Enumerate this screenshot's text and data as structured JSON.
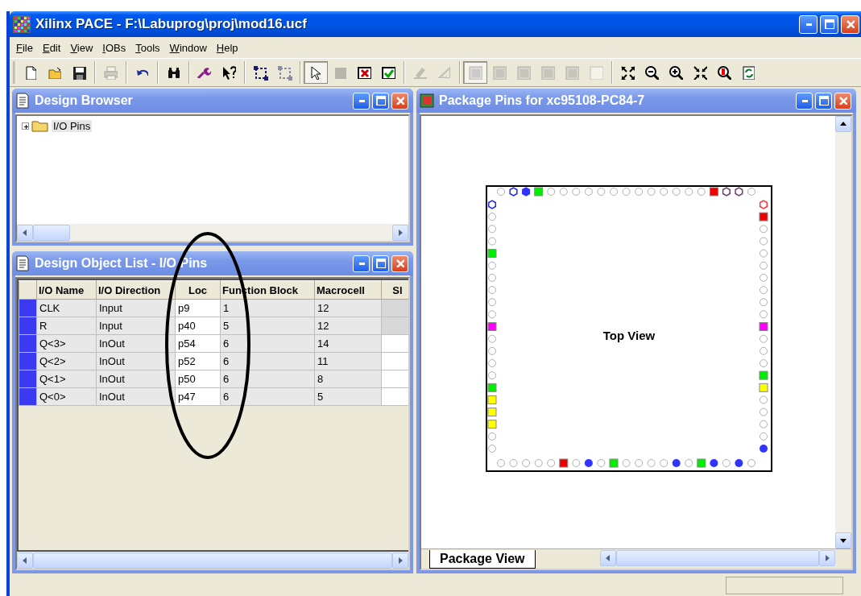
{
  "window": {
    "title": "Xilinx PACE - F:\\Labuprog\\proj\\mod16.ucf"
  },
  "menu": [
    "File",
    "Edit",
    "View",
    "IOBs",
    "Tools",
    "Window",
    "Help"
  ],
  "toolbar_groups": [
    {
      "buttons": [
        {
          "kind": "new",
          "disabled": false,
          "pressed": false
        },
        {
          "kind": "open",
          "disabled": false,
          "pressed": false
        },
        {
          "kind": "save",
          "disabled": false,
          "pressed": false
        }
      ]
    },
    {
      "buttons": [
        {
          "kind": "print",
          "disabled": true,
          "pressed": false
        }
      ]
    },
    {
      "buttons": [
        {
          "kind": "undo",
          "disabled": false,
          "pressed": false
        }
      ]
    },
    {
      "buttons": [
        {
          "kind": "find",
          "disabled": false,
          "pressed": false
        }
      ]
    },
    {
      "buttons": [
        {
          "kind": "wrench",
          "disabled": false,
          "pressed": false
        },
        {
          "kind": "help",
          "disabled": false,
          "pressed": false
        }
      ]
    },
    {
      "buttons": [
        {
          "kind": "select-area",
          "disabled": false,
          "pressed": false
        },
        {
          "kind": "select-area",
          "disabled": true,
          "pressed": false
        }
      ]
    },
    {
      "buttons": [
        {
          "kind": "pointer",
          "disabled": false,
          "pressed": true
        },
        {
          "kind": "square",
          "disabled": true,
          "pressed": false
        },
        {
          "kind": "x-box",
          "disabled": false,
          "pressed": false
        },
        {
          "kind": "check-box",
          "disabled": false,
          "pressed": false
        }
      ]
    },
    {
      "buttons": [
        {
          "kind": "pen",
          "disabled": true,
          "pressed": false
        },
        {
          "kind": "ruler",
          "disabled": true,
          "pressed": false
        }
      ]
    },
    {
      "buttons": [
        {
          "kind": "pattern",
          "disabled": true,
          "pressed": true
        },
        {
          "kind": "pattern",
          "disabled": true,
          "pressed": false
        },
        {
          "kind": "pattern",
          "disabled": true,
          "pressed": false
        },
        {
          "kind": "pattern",
          "disabled": true,
          "pressed": false
        },
        {
          "kind": "pattern",
          "disabled": true,
          "pressed": false
        },
        {
          "kind": "blank",
          "disabled": true,
          "pressed": false
        }
      ]
    },
    {
      "buttons": [
        {
          "kind": "fit",
          "disabled": false,
          "pressed": false
        },
        {
          "kind": "zoom-out",
          "disabled": false,
          "pressed": false
        },
        {
          "kind": "zoom-in",
          "disabled": false,
          "pressed": false
        },
        {
          "kind": "shrink",
          "disabled": false,
          "pressed": false
        },
        {
          "kind": "zoom-red",
          "disabled": false,
          "pressed": false
        },
        {
          "kind": "refresh",
          "disabled": false,
          "pressed": false
        }
      ]
    }
  ],
  "design_browser": {
    "title": "Design Browser",
    "tree": [
      {
        "label": "I/O Pins",
        "expanded": false,
        "selected": true
      }
    ]
  },
  "object_list": {
    "title": "Design Object List - I/O Pins",
    "columns": [
      "I/O Name",
      "I/O Direction",
      "Loc",
      "Function Block",
      "Macrocell",
      "Sl"
    ],
    "rows": [
      {
        "name": "CLK",
        "direction": "Input",
        "loc": "p9",
        "function_block": "1",
        "macrocell": "12",
        "column_6_editable": false
      },
      {
        "name": "R",
        "direction": "Input",
        "loc": "p40",
        "function_block": "5",
        "macrocell": "12",
        "column_6_editable": false
      },
      {
        "name": "Q<3>",
        "direction": "InOut",
        "loc": "p54",
        "function_block": "6",
        "macrocell": "14",
        "column_6_editable": true
      },
      {
        "name": "Q<2>",
        "direction": "InOut",
        "loc": "p52",
        "function_block": "6",
        "macrocell": "11",
        "column_6_editable": true
      },
      {
        "name": "Q<1>",
        "direction": "InOut",
        "loc": "p50",
        "function_block": "6",
        "macrocell": "8",
        "column_6_editable": true
      },
      {
        "name": "Q<0>",
        "direction": "InOut",
        "loc": "p47",
        "function_block": "6",
        "macrocell": "5",
        "column_6_editable": true
      }
    ]
  },
  "package": {
    "title": "Package Pins for xc95108-PC84-7",
    "label": "Top View",
    "pins": {
      "top": [
        {
          "kind": "empty"
        },
        {
          "kind": "hex",
          "color": "#2222ff"
        },
        {
          "kind": "solid-hex",
          "color": "#3333ff"
        },
        {
          "kind": "square",
          "color": "#00ee00"
        },
        {
          "kind": "empty"
        },
        {
          "kind": "empty"
        },
        {
          "kind": "empty"
        },
        {
          "kind": "empty"
        },
        {
          "kind": "empty"
        },
        {
          "kind": "empty"
        },
        {
          "kind": "empty"
        },
        {
          "kind": "empty"
        },
        {
          "kind": "empty"
        },
        {
          "kind": "empty"
        },
        {
          "kind": "empty"
        },
        {
          "kind": "empty"
        },
        {
          "kind": "empty"
        },
        {
          "kind": "square",
          "color": "#ee0000"
        },
        {
          "kind": "hex",
          "color": "#6b3f6b"
        },
        {
          "kind": "hex",
          "color": "#6b3f6b"
        },
        {
          "kind": "empty"
        }
      ],
      "left": [
        {
          "kind": "hex",
          "color": "#2222ff"
        },
        {
          "kind": "empty"
        },
        {
          "kind": "empty"
        },
        {
          "kind": "empty"
        },
        {
          "kind": "square",
          "color": "#00ee00"
        },
        {
          "kind": "empty"
        },
        {
          "kind": "empty"
        },
        {
          "kind": "empty"
        },
        {
          "kind": "empty"
        },
        {
          "kind": "empty"
        },
        {
          "kind": "square",
          "color": "#ff00ff"
        },
        {
          "kind": "empty"
        },
        {
          "kind": "empty"
        },
        {
          "kind": "empty"
        },
        {
          "kind": "empty"
        },
        {
          "kind": "square",
          "color": "#00ee00"
        },
        {
          "kind": "square",
          "color": "#ffff00"
        },
        {
          "kind": "square",
          "color": "#ffff00"
        },
        {
          "kind": "square",
          "color": "#ffff00"
        },
        {
          "kind": "empty"
        },
        {
          "kind": "empty"
        }
      ],
      "right": [
        {
          "kind": "hex",
          "color": "#ff3333"
        },
        {
          "kind": "square",
          "color": "#ee0000"
        },
        {
          "kind": "empty"
        },
        {
          "kind": "empty"
        },
        {
          "kind": "empty"
        },
        {
          "kind": "empty"
        },
        {
          "kind": "empty"
        },
        {
          "kind": "empty"
        },
        {
          "kind": "empty"
        },
        {
          "kind": "empty"
        },
        {
          "kind": "square",
          "color": "#ff00ff"
        },
        {
          "kind": "empty"
        },
        {
          "kind": "empty"
        },
        {
          "kind": "empty"
        },
        {
          "kind": "square",
          "color": "#00ee00"
        },
        {
          "kind": "square",
          "color": "#ffff00"
        },
        {
          "kind": "empty"
        },
        {
          "kind": "empty"
        },
        {
          "kind": "empty"
        },
        {
          "kind": "empty"
        },
        {
          "kind": "dot",
          "color": "#3333ff"
        }
      ],
      "bottom": [
        {
          "kind": "empty"
        },
        {
          "kind": "empty"
        },
        {
          "kind": "empty"
        },
        {
          "kind": "empty"
        },
        {
          "kind": "empty"
        },
        {
          "kind": "square",
          "color": "#ee0000"
        },
        {
          "kind": "empty"
        },
        {
          "kind": "dot",
          "color": "#3333ff"
        },
        {
          "kind": "empty"
        },
        {
          "kind": "square",
          "color": "#00ee00"
        },
        {
          "kind": "empty"
        },
        {
          "kind": "empty"
        },
        {
          "kind": "empty"
        },
        {
          "kind": "empty"
        },
        {
          "kind": "dot",
          "color": "#3333ff"
        },
        {
          "kind": "empty"
        },
        {
          "kind": "square",
          "color": "#00ee00"
        },
        {
          "kind": "dot",
          "color": "#3333ff"
        },
        {
          "kind": "empty"
        },
        {
          "kind": "dot",
          "color": "#3333ff"
        },
        {
          "kind": "empty"
        }
      ]
    },
    "tabs": [
      {
        "label": "Package View",
        "selected": true
      }
    ]
  }
}
